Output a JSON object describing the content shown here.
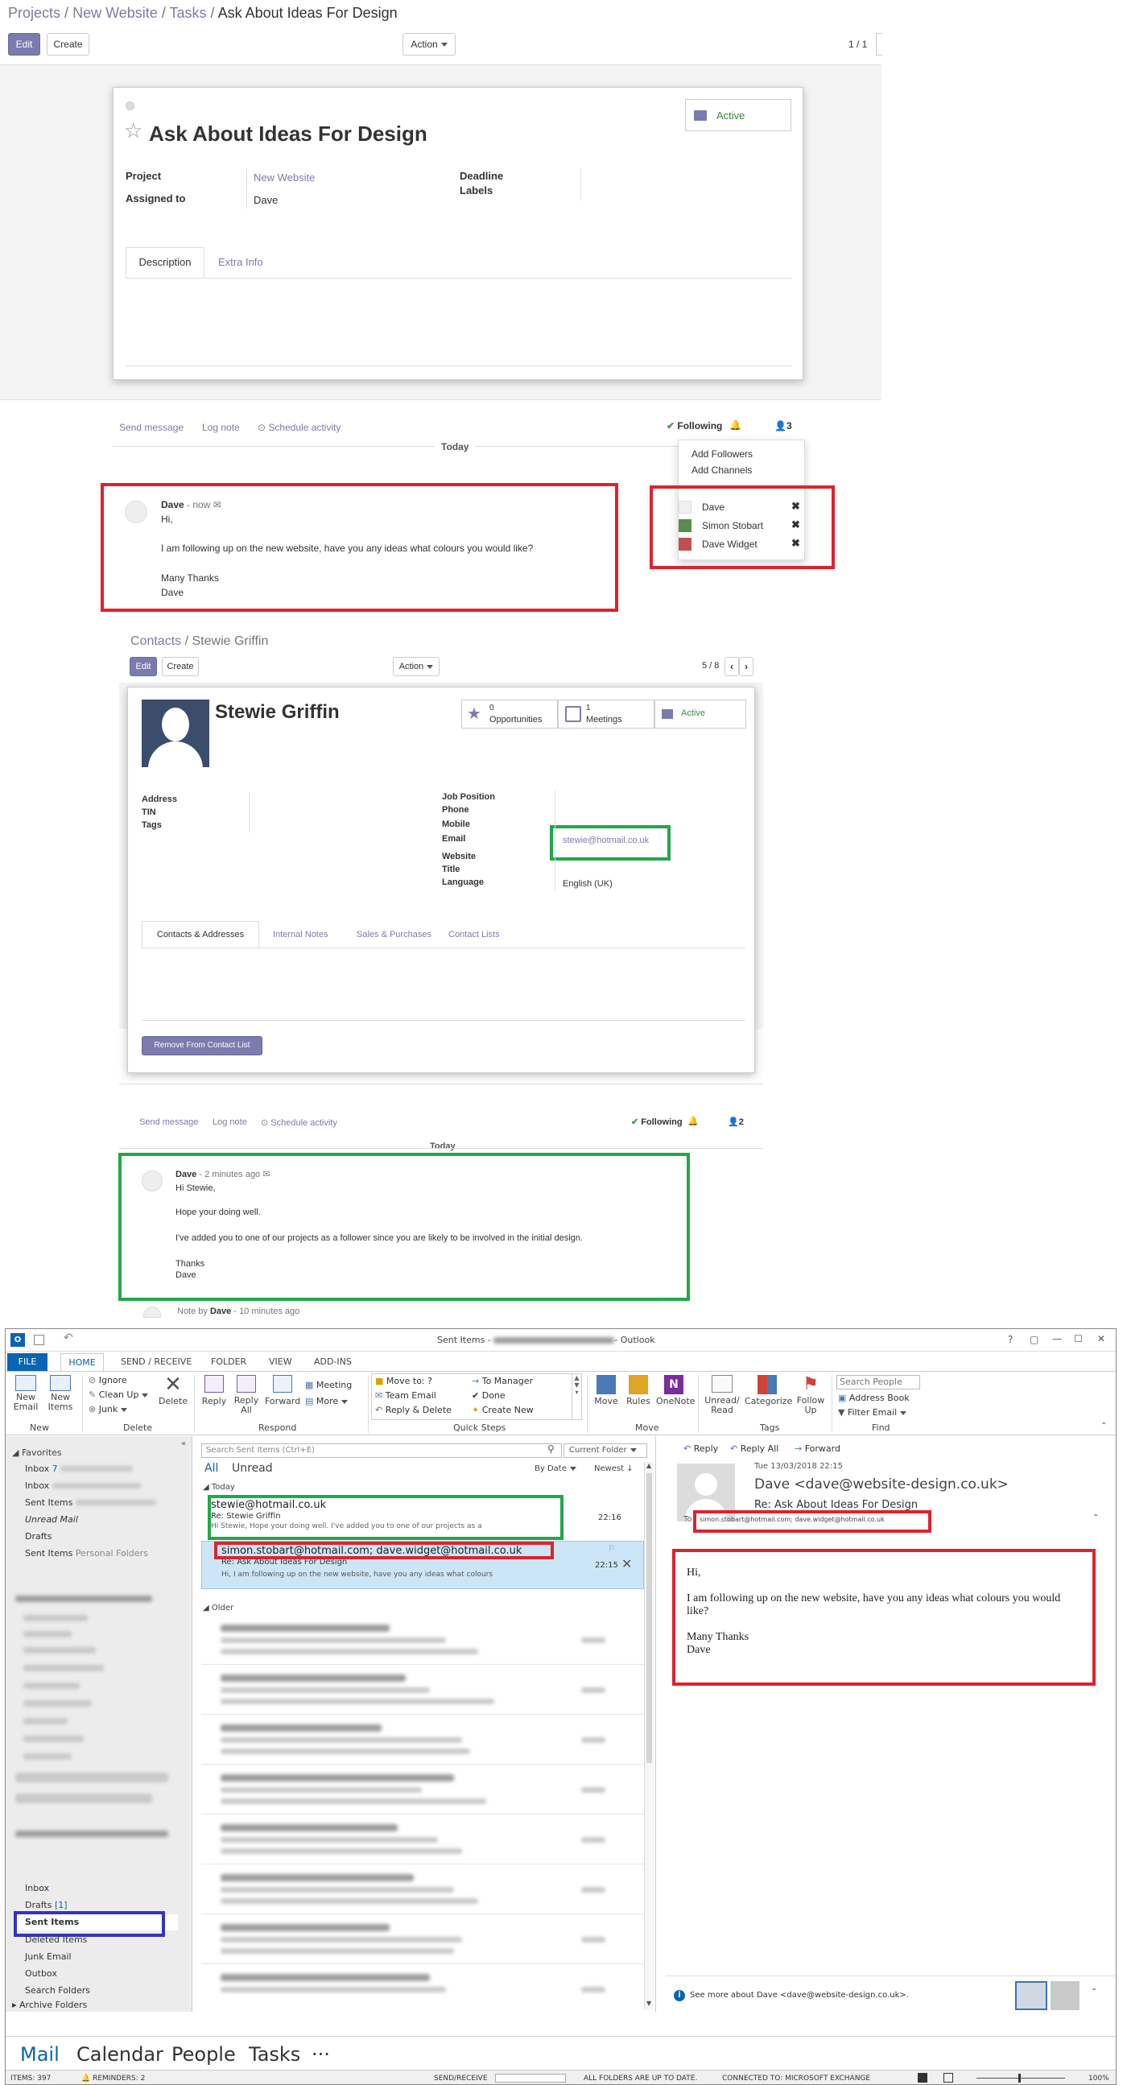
{
  "odoo_task": {
    "breadcrumb": {
      "projects": "Projects",
      "sep1": "/",
      "project": "New Website",
      "sep2": "/",
      "tasks": "Tasks",
      "sep3": "/",
      "current": "Ask About Ideas For Design"
    },
    "edit": "Edit",
    "create": "Create",
    "action": "Action",
    "pager": "1 / 1",
    "status": "Active",
    "title": "Ask About Ideas For Design",
    "fields": {
      "project_label": "Project",
      "project_value": "New Website",
      "assigned_label": "Assigned to",
      "assigned_value": "Dave",
      "deadline_label": "Deadline",
      "labels_label": "Labels"
    },
    "tabs": [
      "Description",
      "Extra Info"
    ],
    "chatter": {
      "send_message": "Send message",
      "log_note": "Log note",
      "schedule": "Schedule activity",
      "following": "Following",
      "followers_count": "3",
      "today": "Today",
      "menu": {
        "add_followers": "Add Followers",
        "add_channels": "Add Channels"
      },
      "followers": [
        "Dave",
        "Simon Stobart",
        "Dave Widget"
      ]
    },
    "message": {
      "author": "Dave",
      "time": "- now",
      "lines": [
        "Hi,",
        "I am following up on the new website, have you any ideas what colours you would like?",
        "Many Thanks",
        "Dave"
      ]
    }
  },
  "odoo_contact": {
    "breadcrumb": {
      "contacts": "Contacts",
      "sep": "/",
      "current": "Stewie Griffin"
    },
    "edit": "Edit",
    "create": "Create",
    "action": "Action",
    "pager": "5 / 8",
    "name": "Stewie Griffin",
    "stats": {
      "opp_count": "0",
      "opp_label": "Opportunities",
      "meet_count": "1",
      "meet_label": "Meetings",
      "active": "Active"
    },
    "left_fields": [
      "Address",
      "TIN",
      "Tags"
    ],
    "right_fields": {
      "job_position": "Job Position",
      "phone": "Phone",
      "mobile": "Mobile",
      "email_label": "Email",
      "email_value": "stewie@hotmail.co.uk",
      "website": "Website",
      "title": "Title",
      "language_label": "Language",
      "language_value": "English (UK)"
    },
    "tabs": [
      "Contacts & Addresses",
      "Internal Notes",
      "Sales & Purchases",
      "Contact Lists"
    ],
    "remove_button": "Remove From Contact List",
    "chatter": {
      "send_message": "Send message",
      "log_note": "Log note",
      "schedule": "Schedule activity",
      "following": "Following",
      "followers_count": "2",
      "today": "Today"
    },
    "message": {
      "author": "Dave",
      "time": "- 2 minutes ago",
      "lines": [
        "Hi Stewie,",
        "Hope your doing well.",
        "I've added you to one of our projects as a follower since you are likely to be involved in the initial design.",
        "Thanks",
        "Dave"
      ]
    },
    "note": {
      "prefix": "Note by",
      "author": "Dave",
      "time": "- 10 minutes ago"
    }
  },
  "outlook": {
    "title": "Sent Items - ",
    "title_suffix": "- Outlook",
    "win_buttons": [
      "?",
      "▢",
      "—",
      "☐",
      "✕"
    ],
    "tabs": [
      "FILE",
      "HOME",
      "SEND / RECEIVE",
      "FOLDER",
      "VIEW",
      "ADD-INS"
    ],
    "ribbon": {
      "new_email": "New\nEmail",
      "new_items": "New\nItems",
      "ignore": "Ignore",
      "clean_up": "Clean Up",
      "junk": "Junk",
      "delete": "Delete",
      "reply": "Reply",
      "reply_all": "Reply\nAll",
      "forward": "Forward",
      "meeting": "Meeting",
      "more": "More",
      "qs": [
        "Move to: ?",
        "To Manager",
        "Team Email",
        "Done",
        "Reply & Delete",
        "Create New"
      ],
      "move": "Move",
      "rules": "Rules",
      "onenote": "OneNote",
      "unread_read": "Unread/\nRead",
      "categorize": "Categorize",
      "follow_up": "Follow\nUp",
      "search_people": "Search People",
      "address_book": "Address Book",
      "filter_email": "Filter Email",
      "groups": [
        "New",
        "Delete",
        "Respond",
        "Quick Steps",
        "Move",
        "Tags",
        "Find"
      ]
    },
    "folders": {
      "favorites": "Favorites",
      "fav_items": [
        "Inbox",
        "Inbox",
        "Sent Items",
        "Unread Mail",
        "Drafts",
        "Sent Items"
      ],
      "inbox_count": "7",
      "personal_folders": "Personal Folders",
      "bottom": [
        "Inbox",
        "Drafts",
        "Sent Items",
        "Deleted Items",
        "Junk Email",
        "Outbox",
        "Search Folders"
      ],
      "drafts_count": "[1]",
      "archive": "Archive Folders"
    },
    "list": {
      "search_placeholder": "Search Sent Items (Ctrl+E)",
      "current_folder": "Current Folder",
      "all": "All",
      "unread": "Unread",
      "by_date": "By Date",
      "newest": "Newest",
      "today": "Today",
      "older": "Older",
      "items": [
        {
          "to": "stewie@hotmail.co.uk",
          "subject": "Re: Stewie Griffin",
          "preview": "Hi Stewie,  Hope your doing well.  I've added you to one of our projects as a",
          "time": "22:16"
        },
        {
          "to": "simon.stobart@hotmail.com; dave.widget@hotmail.co.uk",
          "subject": "Re: Ask About Ideas For Design",
          "preview": "Hi,  I am following up on the new website, have you any ideas what colours",
          "time": "22:15"
        }
      ]
    },
    "reading": {
      "reply": "Reply",
      "reply_all": "Reply All",
      "forward": "Forward",
      "date": "Tue 13/03/2018 22:15",
      "from": "Dave <dave@website-design.co.uk>",
      "subject": "Re: Ask About Ideas For Design",
      "to_label": "To",
      "to_value": "simon.stobart@hotmail.com; dave.widget@hotmail.co.uk",
      "body": [
        "Hi,",
        "I am following up on the new website, have you any ideas what colours you would like?",
        "Many Thanks",
        "Dave"
      ],
      "see_more": "See more about Dave <dave@website-design.co.uk>."
    },
    "nav": [
      "Mail",
      "Calendar",
      "People",
      "Tasks",
      "···"
    ],
    "status": {
      "items": "ITEMS: 397",
      "reminders": "REMINDERS: 2",
      "send_receive": "SEND/RECEIVE",
      "folders": "ALL FOLDERS ARE UP TO DATE.",
      "connected": "CONNECTED TO: MICROSOFT EXCHANGE",
      "zoom": "100%"
    }
  }
}
